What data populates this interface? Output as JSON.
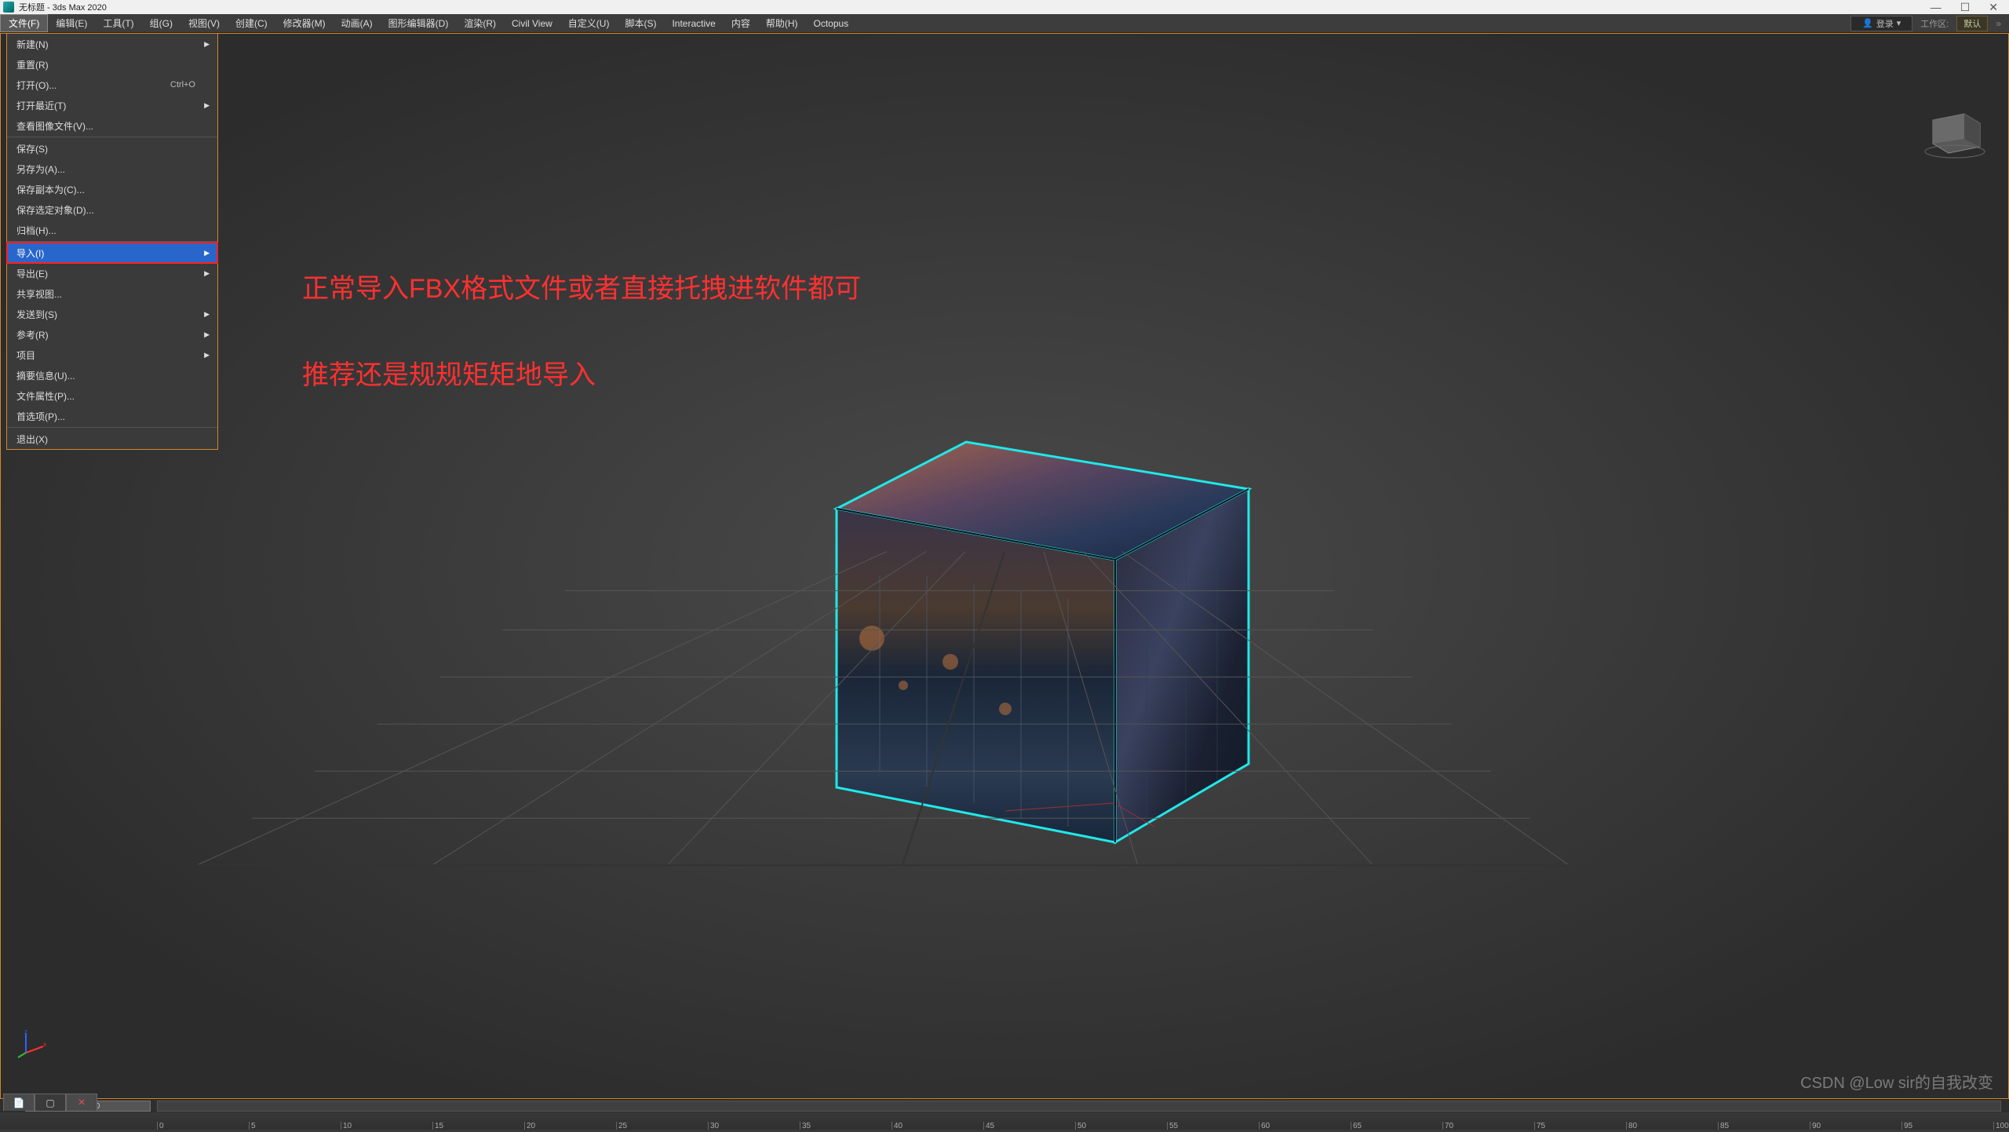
{
  "window": {
    "title": "无标题 - 3ds Max 2020"
  },
  "menubar": {
    "items": [
      "文件(F)",
      "编辑(E)",
      "工具(T)",
      "组(G)",
      "视图(V)",
      "创建(C)",
      "修改器(M)",
      "动画(A)",
      "图形编辑器(D)",
      "渲染(R)",
      "Civil View",
      "自定义(U)",
      "脚本(S)",
      "Interactive",
      "内容",
      "帮助(H)",
      "Octopus"
    ],
    "login": "登录",
    "workspace_label": "工作区:",
    "workspace_value": "默认"
  },
  "file_menu": {
    "items": [
      {
        "label": "新建(N)",
        "arrow": true
      },
      {
        "label": "重置(R)"
      },
      {
        "label": "打开(O)...",
        "shortcut": "Ctrl+O"
      },
      {
        "label": "打开最近(T)",
        "arrow": true
      },
      {
        "label": "查看图像文件(V)..."
      },
      {
        "sep": true
      },
      {
        "label": "保存(S)"
      },
      {
        "label": "另存为(A)..."
      },
      {
        "label": "保存副本为(C)..."
      },
      {
        "label": "保存选定对象(D)..."
      },
      {
        "label": "归档(H)..."
      },
      {
        "sep": true
      },
      {
        "label": "导入(I)",
        "arrow": true,
        "highlight": true,
        "red": true
      },
      {
        "label": "导出(E)",
        "arrow": true
      },
      {
        "label": "共享视图..."
      },
      {
        "label": "发送到(S)",
        "arrow": true
      },
      {
        "label": "参考(R)",
        "arrow": true
      },
      {
        "label": "项目",
        "arrow": true
      },
      {
        "label": "摘要信息(U)..."
      },
      {
        "label": "文件属性(P)..."
      },
      {
        "label": "首选项(P)..."
      },
      {
        "sep": true
      },
      {
        "label": "退出(X)"
      }
    ]
  },
  "annotations": {
    "line1": "正常导入FBX格式文件或者直接托拽进软件都可",
    "line2": "推荐还是规规矩矩地导入"
  },
  "timeline": {
    "handle": "0 / 100",
    "ticks": [
      0,
      5,
      10,
      15,
      20,
      25,
      30,
      35,
      40,
      45,
      50,
      55,
      60,
      65,
      70,
      75,
      80,
      85,
      90,
      95,
      100
    ]
  },
  "watermark": "CSDN @Low sir的自我改变"
}
